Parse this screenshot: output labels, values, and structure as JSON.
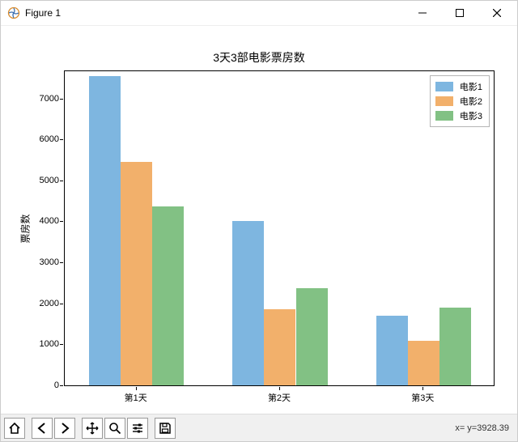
{
  "window": {
    "title": "Figure 1",
    "controls": {
      "minimize": "minimize",
      "maximize": "maximize",
      "close": "close"
    }
  },
  "chart_data": {
    "type": "bar",
    "title": "3天3部电影票房数",
    "ylabel": "票房数",
    "xlabel": "",
    "categories": [
      "第1天",
      "第2天",
      "第3天"
    ],
    "series": [
      {
        "name": "电影1",
        "values": [
          7550,
          4000,
          1690
        ],
        "color": "#7eb6e0"
      },
      {
        "name": "电影2",
        "values": [
          5450,
          1850,
          1090
        ],
        "color": "#f2b06b"
      },
      {
        "name": "电影3",
        "values": [
          4370,
          2360,
          1900
        ],
        "color": "#82c184"
      }
    ],
    "ylim": [
      0,
      7500
    ],
    "yticks": [
      0,
      1000,
      2000,
      3000,
      4000,
      5000,
      6000,
      7000
    ],
    "legend_position": "upper right"
  },
  "toolbar": {
    "home": "home",
    "back": "back",
    "forward": "forward",
    "pan": "pan",
    "zoom": "zoom",
    "configure": "configure",
    "save": "save"
  },
  "status": {
    "text": "x= y=3928.39"
  }
}
